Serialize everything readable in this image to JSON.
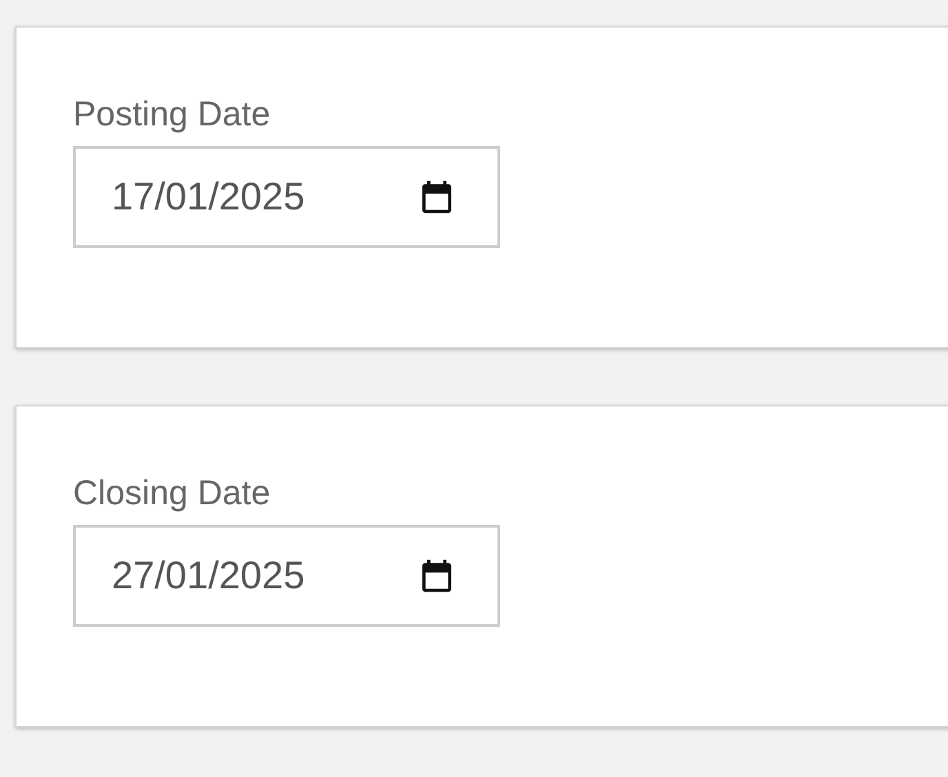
{
  "cards": [
    {
      "label": "Posting Date",
      "value": "17/01/2025"
    },
    {
      "label": "Closing Date",
      "value": "27/01/2025"
    }
  ]
}
